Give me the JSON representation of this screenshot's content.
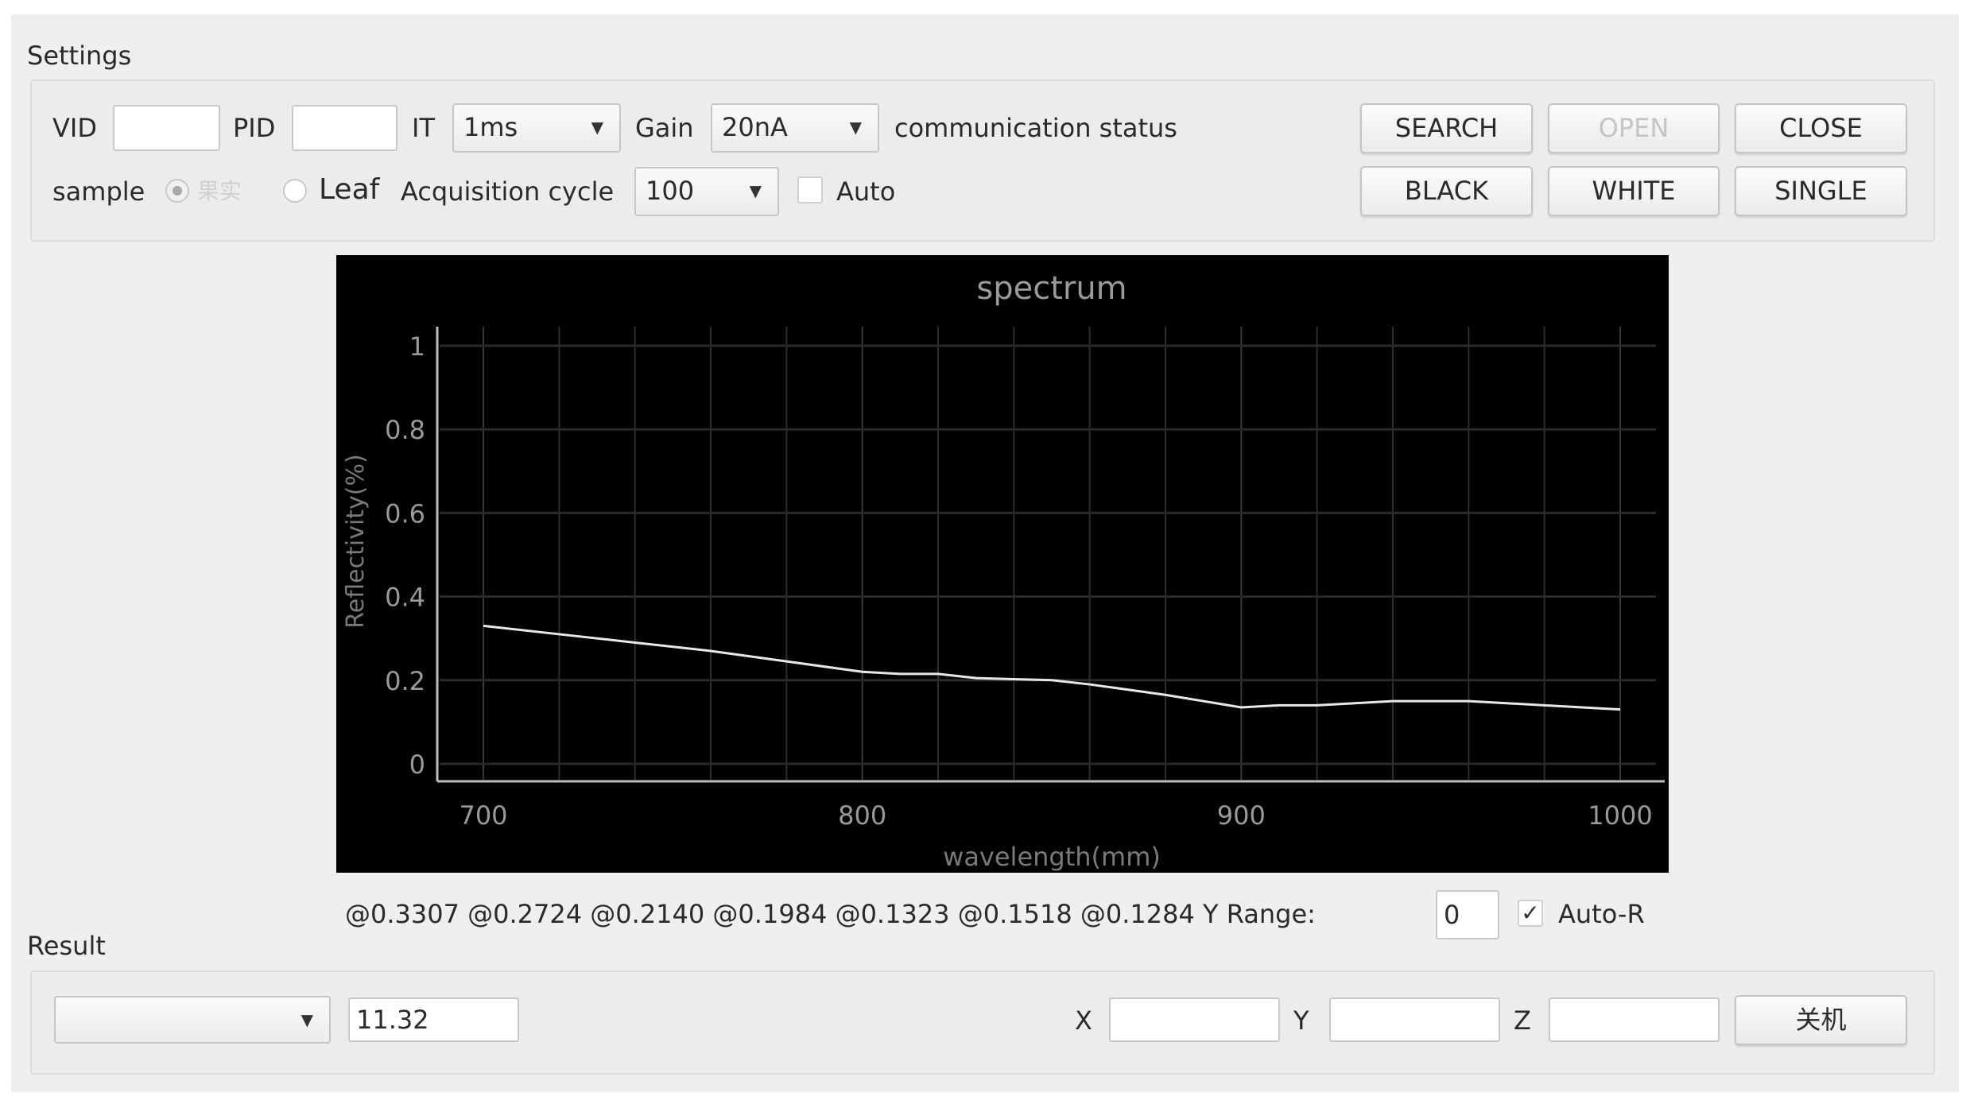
{
  "settings": {
    "title": "Settings",
    "vid_label": "VID",
    "vid_value": "",
    "pid_label": "PID",
    "pid_value": "",
    "it_label": "IT",
    "it_value": "1ms",
    "gain_label": "Gain",
    "gain_value": "20nA",
    "comm_status": "communication status",
    "sample_label": "sample",
    "sample_option_fruit": "果实",
    "sample_option_leaf": "Leaf",
    "acq_label": "Acquisition cycle",
    "acq_value": "100",
    "auto_label": "Auto",
    "buttons": {
      "search": "SEARCH",
      "open": "OPEN",
      "close": "CLOSE",
      "black": "BLACK",
      "white": "WHITE",
      "single": "SINGLE"
    }
  },
  "readout": {
    "values": [
      "@0.3307",
      "@0.2724",
      "@0.2140",
      "@0.1984",
      "@0.1323",
      "@0.1518",
      "@0.1284"
    ],
    "y_range_label": "Y Range:",
    "y_range_value": "0",
    "auto_r_label": "Auto-R",
    "auto_r_checked": true
  },
  "result": {
    "title": "Result",
    "combo_value": "",
    "value": "11.32",
    "x_label": "X",
    "x_value": "",
    "y_label": "Y",
    "y_value": "",
    "z_label": "Z",
    "z_value": "",
    "shutdown_label": "关机"
  },
  "chart_data": {
    "type": "line",
    "title": "spectrum",
    "xlabel": "wavelength(mm)",
    "ylabel": "Reflectivity(%)",
    "xlim": [
      700,
      1000
    ],
    "ylim": [
      0,
      1
    ],
    "xticks": [
      "700",
      "800",
      "900",
      "1000"
    ],
    "yticks": [
      "0",
      "0.2",
      "0.4",
      "0.6",
      "0.8",
      "1"
    ],
    "grid": true,
    "series": [
      {
        "name": "spectrum",
        "x": [
          700,
          720,
          740,
          760,
          780,
          800,
          810,
          820,
          830,
          850,
          860,
          880,
          900,
          910,
          920,
          930,
          940,
          960,
          970,
          980,
          990,
          1000
        ],
        "y": [
          0.33,
          0.31,
          0.29,
          0.27,
          0.245,
          0.22,
          0.215,
          0.215,
          0.205,
          0.2,
          0.19,
          0.165,
          0.135,
          0.14,
          0.14,
          0.145,
          0.15,
          0.15,
          0.145,
          0.14,
          0.135,
          0.13
        ]
      }
    ],
    "colors": {
      "background": "#000000",
      "line": "#e8e8e8",
      "grid": "#2e2e2e",
      "text": "#9a9a9a"
    }
  }
}
